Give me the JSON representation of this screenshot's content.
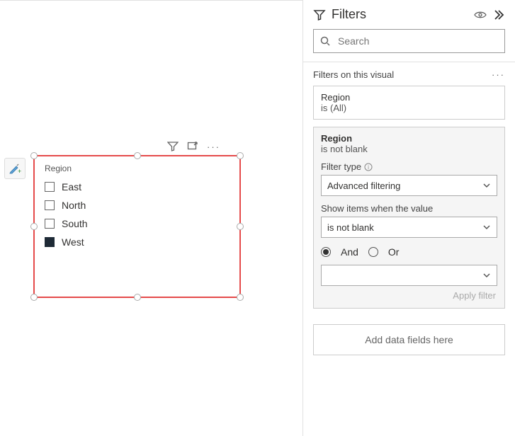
{
  "canvas": {
    "visual": {
      "title": "Region",
      "items": [
        {
          "label": "East",
          "checked": false
        },
        {
          "label": "North",
          "checked": false
        },
        {
          "label": "South",
          "checked": false
        },
        {
          "label": "West",
          "checked": true
        }
      ]
    }
  },
  "filtersPane": {
    "title": "Filters",
    "search": {
      "placeholder": "Search"
    },
    "sectionTitle": "Filters on this visual",
    "summaryCard": {
      "field": "Region",
      "condition": "is (All)"
    },
    "expandedCard": {
      "field": "Region",
      "condition": "is not blank",
      "filterTypeLabel": "Filter type",
      "filterTypeValue": "Advanced filtering",
      "showItemsLabel": "Show items when the value",
      "condition1Value": "is not blank",
      "logic": {
        "and": "And",
        "or": "Or",
        "selected": "and"
      },
      "condition2Value": "",
      "applyLabel": "Apply filter"
    },
    "addFields": "Add data fields here"
  }
}
